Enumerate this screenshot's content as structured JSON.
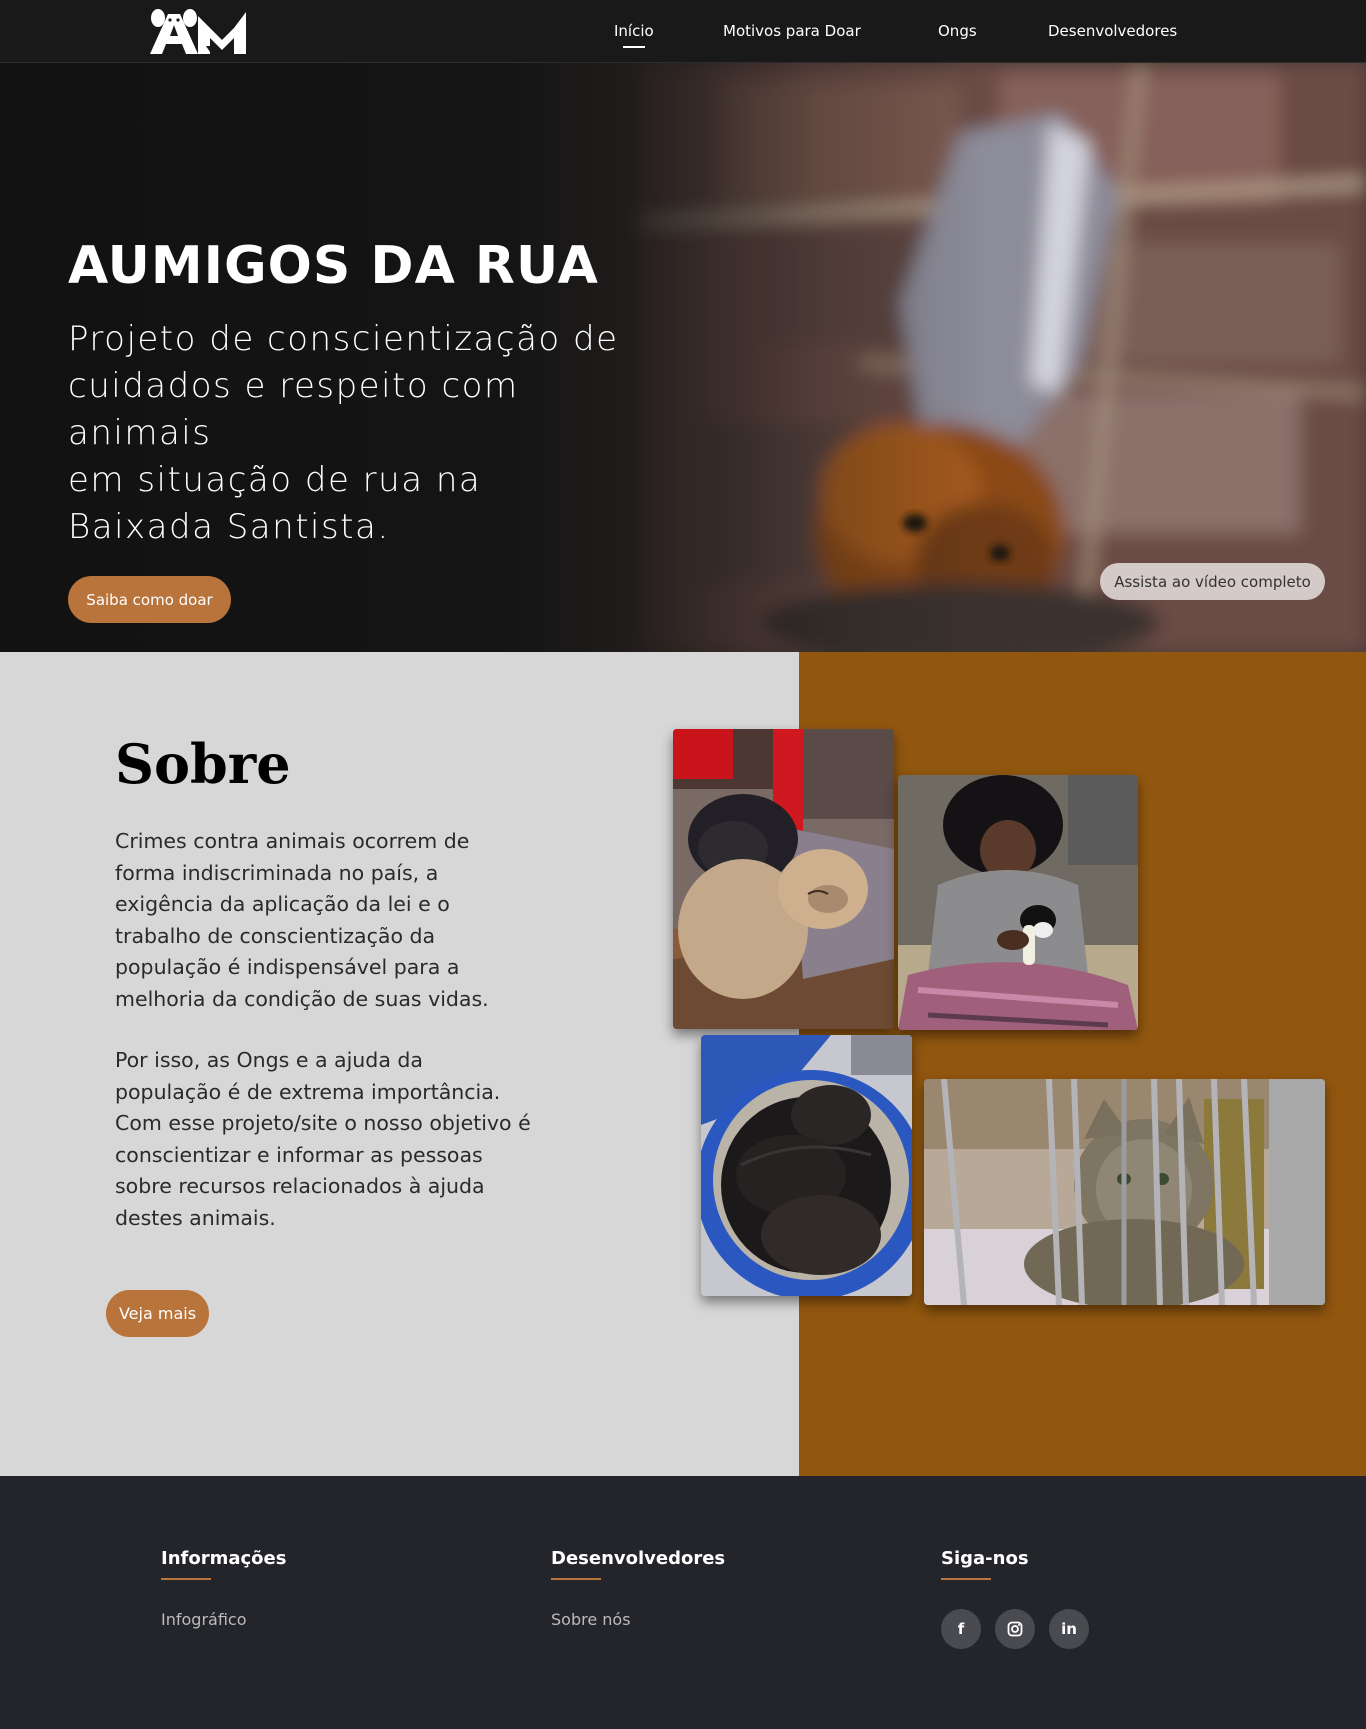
{
  "nav": {
    "logo_text": "AM",
    "links": [
      {
        "label": "Início",
        "active": true
      },
      {
        "label": "Motivos para Doar",
        "active": false
      },
      {
        "label": "Ongs",
        "active": false
      },
      {
        "label": "Desenvolvedores",
        "active": false
      }
    ]
  },
  "hero": {
    "title": "AUMIGOS DA RUA",
    "subtitle_lines": [
      "Projeto de conscientização de",
      "cuidados e respeito com",
      "animais",
      "em situação de rua na",
      "Baixada Santista."
    ],
    "donate_button": "Saiba como doar",
    "video_button": "Assista ao vídeo completo"
  },
  "about": {
    "title": "Sobre",
    "paragraph_1": "Crimes contra animais ocorrem de forma indiscriminada no país, a exigência da aplicação da lei e o trabalho de conscientização da população é indispensável para a melhoria da condição de suas vidas.",
    "paragraph_2": "Por isso, as Ongs e a ajuda da população é de extrema importância. Com esse projeto/site o nosso objetivo é conscientizar e informar as pessoas sobre recursos relacionados à ajuda destes animais.",
    "more_button": "Veja mais",
    "accent_color": "#92570f"
  },
  "footer": {
    "columns": [
      {
        "heading": "Informações",
        "link": "Infográfico"
      },
      {
        "heading": "Desenvolvedores",
        "link": "Sobre nós"
      },
      {
        "heading": "Siga-nos"
      }
    ],
    "social": [
      {
        "icon": "facebook-icon",
        "glyph": "f"
      },
      {
        "icon": "instagram-icon",
        "glyph": ""
      },
      {
        "icon": "linkedin-icon",
        "glyph": "in"
      }
    ]
  },
  "colors": {
    "brand": "#b8743a",
    "nav_bg": "#191919",
    "footer_bg": "#24252a"
  }
}
